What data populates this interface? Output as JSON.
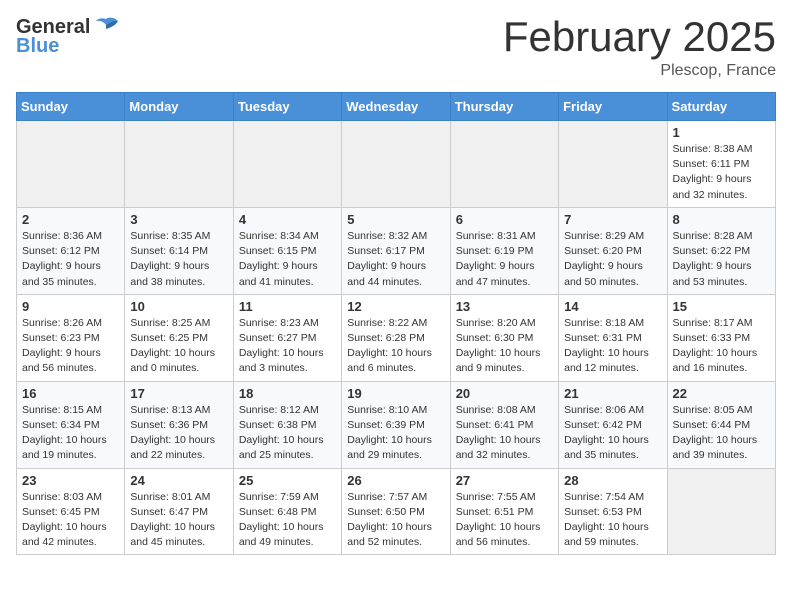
{
  "header": {
    "logo_general": "General",
    "logo_blue": "Blue",
    "month_title": "February 2025",
    "location": "Plescop, France"
  },
  "weekdays": [
    "Sunday",
    "Monday",
    "Tuesday",
    "Wednesday",
    "Thursday",
    "Friday",
    "Saturday"
  ],
  "weeks": [
    [
      {
        "day": "",
        "info": ""
      },
      {
        "day": "",
        "info": ""
      },
      {
        "day": "",
        "info": ""
      },
      {
        "day": "",
        "info": ""
      },
      {
        "day": "",
        "info": ""
      },
      {
        "day": "",
        "info": ""
      },
      {
        "day": "1",
        "info": "Sunrise: 8:38 AM\nSunset: 6:11 PM\nDaylight: 9 hours\nand 32 minutes."
      }
    ],
    [
      {
        "day": "2",
        "info": "Sunrise: 8:36 AM\nSunset: 6:12 PM\nDaylight: 9 hours\nand 35 minutes."
      },
      {
        "day": "3",
        "info": "Sunrise: 8:35 AM\nSunset: 6:14 PM\nDaylight: 9 hours\nand 38 minutes."
      },
      {
        "day": "4",
        "info": "Sunrise: 8:34 AM\nSunset: 6:15 PM\nDaylight: 9 hours\nand 41 minutes."
      },
      {
        "day": "5",
        "info": "Sunrise: 8:32 AM\nSunset: 6:17 PM\nDaylight: 9 hours\nand 44 minutes."
      },
      {
        "day": "6",
        "info": "Sunrise: 8:31 AM\nSunset: 6:19 PM\nDaylight: 9 hours\nand 47 minutes."
      },
      {
        "day": "7",
        "info": "Sunrise: 8:29 AM\nSunset: 6:20 PM\nDaylight: 9 hours\nand 50 minutes."
      },
      {
        "day": "8",
        "info": "Sunrise: 8:28 AM\nSunset: 6:22 PM\nDaylight: 9 hours\nand 53 minutes."
      }
    ],
    [
      {
        "day": "9",
        "info": "Sunrise: 8:26 AM\nSunset: 6:23 PM\nDaylight: 9 hours\nand 56 minutes."
      },
      {
        "day": "10",
        "info": "Sunrise: 8:25 AM\nSunset: 6:25 PM\nDaylight: 10 hours\nand 0 minutes."
      },
      {
        "day": "11",
        "info": "Sunrise: 8:23 AM\nSunset: 6:27 PM\nDaylight: 10 hours\nand 3 minutes."
      },
      {
        "day": "12",
        "info": "Sunrise: 8:22 AM\nSunset: 6:28 PM\nDaylight: 10 hours\nand 6 minutes."
      },
      {
        "day": "13",
        "info": "Sunrise: 8:20 AM\nSunset: 6:30 PM\nDaylight: 10 hours\nand 9 minutes."
      },
      {
        "day": "14",
        "info": "Sunrise: 8:18 AM\nSunset: 6:31 PM\nDaylight: 10 hours\nand 12 minutes."
      },
      {
        "day": "15",
        "info": "Sunrise: 8:17 AM\nSunset: 6:33 PM\nDaylight: 10 hours\nand 16 minutes."
      }
    ],
    [
      {
        "day": "16",
        "info": "Sunrise: 8:15 AM\nSunset: 6:34 PM\nDaylight: 10 hours\nand 19 minutes."
      },
      {
        "day": "17",
        "info": "Sunrise: 8:13 AM\nSunset: 6:36 PM\nDaylight: 10 hours\nand 22 minutes."
      },
      {
        "day": "18",
        "info": "Sunrise: 8:12 AM\nSunset: 6:38 PM\nDaylight: 10 hours\nand 25 minutes."
      },
      {
        "day": "19",
        "info": "Sunrise: 8:10 AM\nSunset: 6:39 PM\nDaylight: 10 hours\nand 29 minutes."
      },
      {
        "day": "20",
        "info": "Sunrise: 8:08 AM\nSunset: 6:41 PM\nDaylight: 10 hours\nand 32 minutes."
      },
      {
        "day": "21",
        "info": "Sunrise: 8:06 AM\nSunset: 6:42 PM\nDaylight: 10 hours\nand 35 minutes."
      },
      {
        "day": "22",
        "info": "Sunrise: 8:05 AM\nSunset: 6:44 PM\nDaylight: 10 hours\nand 39 minutes."
      }
    ],
    [
      {
        "day": "23",
        "info": "Sunrise: 8:03 AM\nSunset: 6:45 PM\nDaylight: 10 hours\nand 42 minutes."
      },
      {
        "day": "24",
        "info": "Sunrise: 8:01 AM\nSunset: 6:47 PM\nDaylight: 10 hours\nand 45 minutes."
      },
      {
        "day": "25",
        "info": "Sunrise: 7:59 AM\nSunset: 6:48 PM\nDaylight: 10 hours\nand 49 minutes."
      },
      {
        "day": "26",
        "info": "Sunrise: 7:57 AM\nSunset: 6:50 PM\nDaylight: 10 hours\nand 52 minutes."
      },
      {
        "day": "27",
        "info": "Sunrise: 7:55 AM\nSunset: 6:51 PM\nDaylight: 10 hours\nand 56 minutes."
      },
      {
        "day": "28",
        "info": "Sunrise: 7:54 AM\nSunset: 6:53 PM\nDaylight: 10 hours\nand 59 minutes."
      },
      {
        "day": "",
        "info": ""
      }
    ]
  ]
}
